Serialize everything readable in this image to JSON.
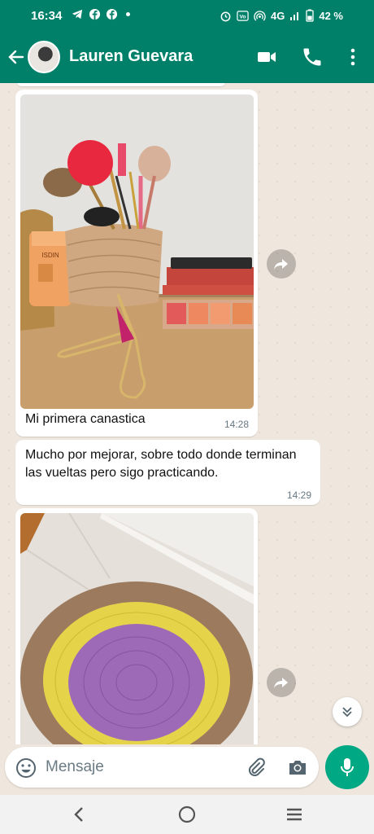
{
  "status": {
    "time": "16:34",
    "battery": "42 %",
    "network": "4G"
  },
  "header": {
    "contact_name": "Lauren Guevara"
  },
  "messages": [
    {
      "type": "image",
      "caption": "Mi primera canastica",
      "time": "14:28"
    },
    {
      "type": "text",
      "text": "Mucho por mejorar, sobre todo donde terminan las vueltas pero sigo practicando.",
      "time": "14:29"
    },
    {
      "type": "image",
      "caption": "",
      "time": ""
    }
  ],
  "photo1_label": {
    "bottle": "ISDIN"
  },
  "input": {
    "placeholder": "Mensaje"
  },
  "colors": {
    "brand": "#008069",
    "accent": "#00a884",
    "chat_bg": "#efe7de"
  },
  "icons": [
    "back-arrow-icon",
    "video-call-icon",
    "phone-icon",
    "more-vert-icon",
    "forward-icon",
    "chevron-double-down-icon",
    "emoji-icon",
    "attach-icon",
    "camera-icon",
    "mic-icon",
    "nav-back-icon",
    "nav-home-icon",
    "nav-recents-icon"
  ]
}
